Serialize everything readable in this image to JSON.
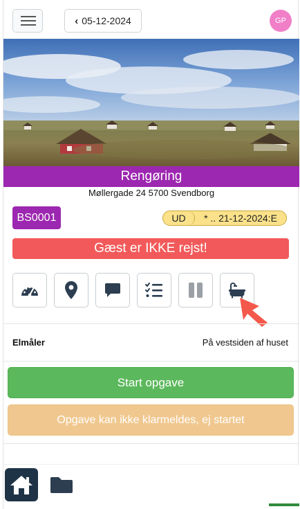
{
  "header": {
    "menu_icon": "hamburger-icon",
    "date_label": "05-12-2024",
    "avatar_initials": "GP"
  },
  "property": {
    "name": "Rengøring",
    "address": "Møllergade 24 5700 Svendborg",
    "code": "BS0001",
    "status_tag": "UD",
    "status_dates": "* .. 21-12-2024:E",
    "alert": "Gæst er IKKE rejst!"
  },
  "icons": [
    {
      "name": "dashboard-gauge-icon"
    },
    {
      "name": "map-marker-icon"
    },
    {
      "name": "comment-icon"
    },
    {
      "name": "checklist-icon"
    },
    {
      "name": "pause-icon"
    },
    {
      "name": "bathtub-icon"
    }
  ],
  "info": {
    "meter_label": "Elmåler",
    "meter_value": "På vestsiden af huset"
  },
  "actions": {
    "start_label": "Start opgave",
    "done_label": "Opgave kan ikke klarmeldes, ej startet"
  },
  "colors": {
    "purple": "#9c27b0",
    "alert_red": "#f2595a",
    "green": "#5cb85c",
    "muted_orange": "#f0c88f",
    "navy": "#1f3346",
    "pill_yellow": "#fbe28a"
  }
}
